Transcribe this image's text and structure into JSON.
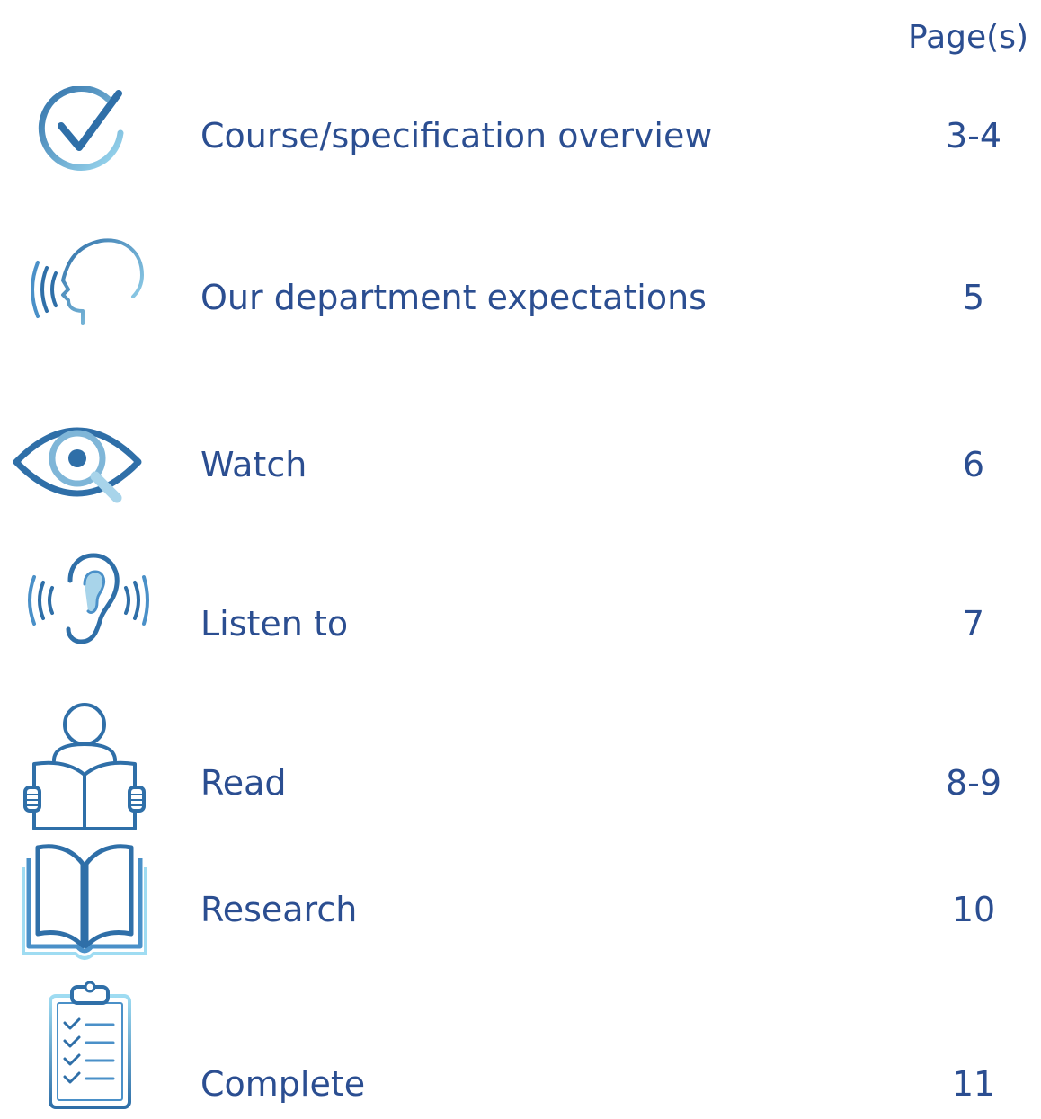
{
  "header": {
    "pages_label": "Page(s)"
  },
  "colors": {
    "text": "#2b4e91",
    "icon_dark": "#2f6fa8",
    "icon_light": "#8fd0ec"
  },
  "contents": [
    {
      "icon": "checkmark-circle-icon",
      "label": "Course/specification overview",
      "pages": "3-4"
    },
    {
      "icon": "speaking-head-icon",
      "label": "Our department expectations",
      "pages": "5"
    },
    {
      "icon": "eye-magnifier-icon",
      "label": "Watch",
      "pages": "6"
    },
    {
      "icon": "ear-sound-icon",
      "label": "Listen to",
      "pages": "7"
    },
    {
      "icon": "person-reading-icon",
      "label": "Read",
      "pages": "8-9"
    },
    {
      "icon": "open-book-icon",
      "label": "Research",
      "pages": "10"
    },
    {
      "icon": "clipboard-checklist-icon",
      "label": "Complete",
      "pages": "11"
    }
  ]
}
